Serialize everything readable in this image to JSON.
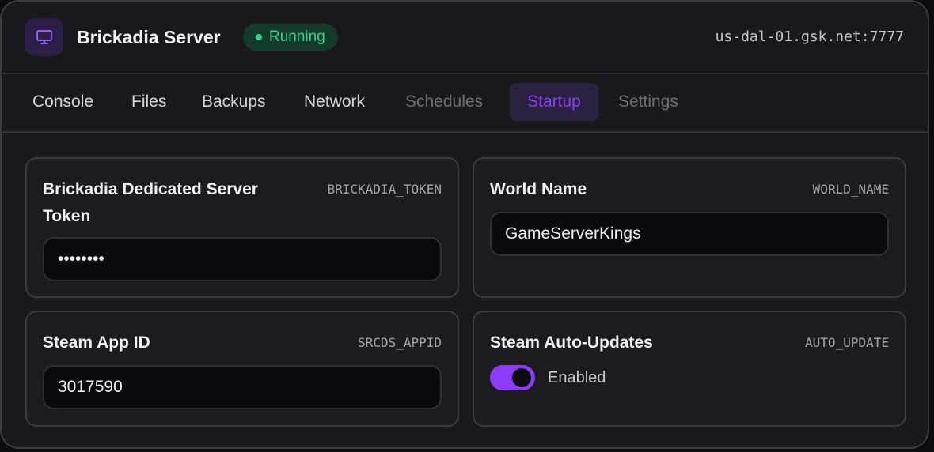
{
  "header": {
    "title": "Brickadia Server",
    "status": "Running",
    "address": "us-dal-01.gsk.net:7777",
    "icon": "monitor-icon"
  },
  "tabs": [
    {
      "label": "Console",
      "state": "normal"
    },
    {
      "label": "Files",
      "state": "normal"
    },
    {
      "label": "Backups",
      "state": "normal"
    },
    {
      "label": "Network",
      "state": "normal"
    },
    {
      "label": "Schedules",
      "state": "disabled"
    },
    {
      "label": "Startup",
      "state": "active"
    },
    {
      "label": "Settings",
      "state": "disabled"
    }
  ],
  "variables": {
    "token": {
      "label": "Brickadia Dedicated Server Token",
      "var": "BRICKADIA_TOKEN",
      "value": "••••••••"
    },
    "world": {
      "label": "World Name",
      "var": "WORLD_NAME",
      "value": "GameServerKings"
    },
    "appid": {
      "label": "Steam App ID",
      "var": "SRCDS_APPID",
      "value": "3017590"
    },
    "autoupdate": {
      "label": "Steam Auto-Updates",
      "var": "AUTO_UPDATE",
      "value": "Enabled",
      "on": true
    }
  },
  "colors": {
    "accent": "#8b3cf7",
    "status_green": "#34d399",
    "background": "#19191c"
  }
}
